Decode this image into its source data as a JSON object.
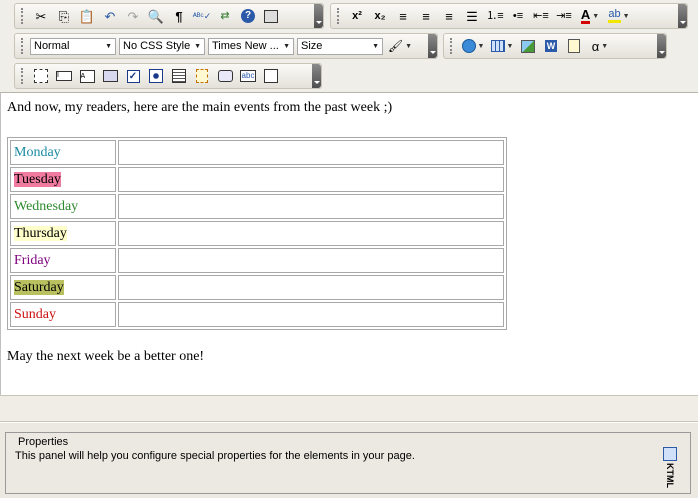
{
  "toolbar_row1": {
    "buttons": [
      "cut-icon",
      "copy-icon",
      "paste-icon",
      "undo-icon",
      "redo-icon",
      "find-icon",
      "pilcrow-icon",
      "spellcheck-icon",
      "replace-icon",
      "help-icon",
      "preview-icon"
    ],
    "format_buttons": [
      "superscript-icon",
      "subscript-icon",
      "align-left-icon",
      "align-center-icon",
      "align-right-icon",
      "justify-icon",
      "ordered-list-icon",
      "unordered-list-icon",
      "outdent-icon",
      "indent-icon",
      "font-color-icon",
      "highlight-icon"
    ],
    "font_color": "#d40000",
    "highlight_color": "#f0e600"
  },
  "toolbar_row2": {
    "paragraph_format": "Normal",
    "css_style": "No CSS Style",
    "font_name": "Times New ...",
    "font_size": "Size",
    "insert_char_label": "α"
  },
  "toolbar_row3": {
    "buttons": [
      "form-icon",
      "textfield-icon",
      "textarea-icon",
      "hidden-field-icon",
      "checkbox-icon",
      "radio-icon",
      "select-list-icon",
      "file-field-icon",
      "button-icon",
      "label-icon",
      "fieldset-icon"
    ]
  },
  "content": {
    "intro": "And now, my readers, here are the main events from the past week ;)",
    "outro": "May the next week be a better one!",
    "days": [
      {
        "name": "Monday",
        "color": "#1a8aa0",
        "bg": ""
      },
      {
        "name": "Tuesday",
        "color": "#000000",
        "bg": "#f07aa0"
      },
      {
        "name": "Wednesday",
        "color": "#2e8a2e",
        "bg": ""
      },
      {
        "name": "Thursday",
        "color": "#000000",
        "bg": "#ffffcc"
      },
      {
        "name": "Friday",
        "color": "#800080",
        "bg": ""
      },
      {
        "name": "Saturday",
        "color": "#000000",
        "bg": "#b8c060"
      },
      {
        "name": "Sunday",
        "color": "#cc1010",
        "bg": ""
      }
    ]
  },
  "properties": {
    "legend": "Properties",
    "text": "This panel will help you configure special properties for the elements in your page.",
    "brand": "KTML"
  }
}
